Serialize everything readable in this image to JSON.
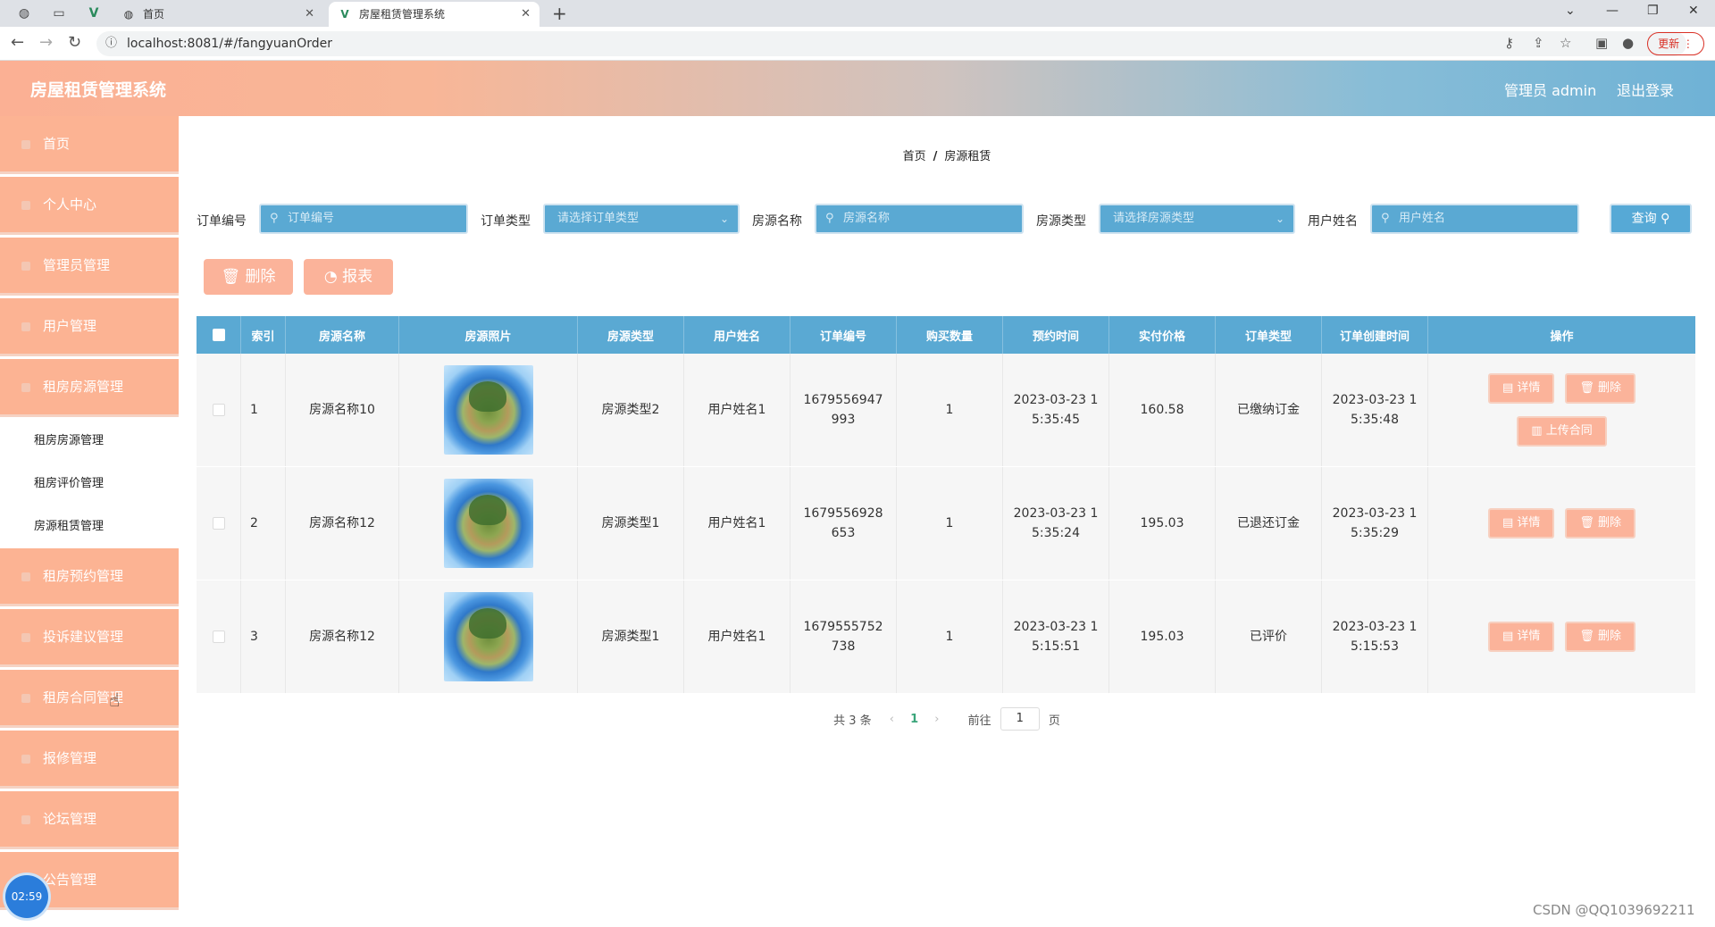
{
  "browser": {
    "tabs": [
      {
        "title": "首页"
      },
      {
        "title": "房屋租赁管理系统"
      }
    ],
    "url": "localhost:8081/#/fangyuanOrder",
    "update_label": "更新"
  },
  "header": {
    "title": "房屋租赁管理系统",
    "user_label": "管理员 admin",
    "logout_label": "退出登录"
  },
  "sidebar": {
    "items_top": [
      {
        "label": "首页"
      },
      {
        "label": "个人中心"
      },
      {
        "label": "管理员管理"
      },
      {
        "label": "用户管理"
      },
      {
        "label": "租房房源管理"
      }
    ],
    "sub_items": [
      {
        "label": "租房房源管理"
      },
      {
        "label": "租房评价管理"
      },
      {
        "label": "房源租赁管理"
      }
    ],
    "items_bottom": [
      {
        "label": "租房预约管理"
      },
      {
        "label": "投诉建议管理"
      },
      {
        "label": "租房合同管理"
      },
      {
        "label": "报修管理"
      },
      {
        "label": "论坛管理"
      },
      {
        "label": "公告管理"
      }
    ]
  },
  "timer": "02:59",
  "breadcrumb": {
    "home": "首页",
    "sep": "/",
    "current": "房源租赁"
  },
  "filters": {
    "order_no": {
      "label": "订单编号",
      "placeholder": "订单编号"
    },
    "order_type": {
      "label": "订单类型",
      "placeholder": "请选择订单类型"
    },
    "house_name": {
      "label": "房源名称",
      "placeholder": "房源名称"
    },
    "house_type": {
      "label": "房源类型",
      "placeholder": "请选择房源类型"
    },
    "user_name": {
      "label": "用户姓名",
      "placeholder": "用户姓名"
    },
    "query_label": "查询"
  },
  "actions": {
    "delete_label": "删除",
    "report_label": "报表"
  },
  "table": {
    "headers": [
      "索引",
      "房源名称",
      "房源照片",
      "房源类型",
      "用户姓名",
      "订单编号",
      "购买数量",
      "预约时间",
      "实付价格",
      "订单类型",
      "订单创建时间",
      "操作"
    ],
    "rows": [
      {
        "index": "1",
        "name": "房源名称10",
        "type": "房源类型2",
        "user": "用户姓名1",
        "order_no": "1679556947993",
        "qty": "1",
        "book_time": "2023-03-23 15:35:45",
        "price": "160.58",
        "order_type": "已缴纳订金",
        "created": "2023-03-23 15:35:48"
      },
      {
        "index": "2",
        "name": "房源名称12",
        "type": "房源类型1",
        "user": "用户姓名1",
        "order_no": "1679556928653",
        "qty": "1",
        "book_time": "2023-03-23 15:35:24",
        "price": "195.03",
        "order_type": "已退还订金",
        "created": "2023-03-23 15:35:29"
      },
      {
        "index": "3",
        "name": "房源名称12",
        "type": "房源类型1",
        "user": "用户姓名1",
        "order_no": "1679555752738",
        "qty": "1",
        "book_time": "2023-03-23 15:15:51",
        "price": "195.03",
        "order_type": "已评价",
        "created": "2023-03-23 15:15:53"
      }
    ],
    "op_detail": "详情",
    "op_delete": "删除",
    "op_upload": "上传合同"
  },
  "pagination": {
    "total_text": "共 3 条",
    "current_page": "1",
    "goto_label": "前往",
    "goto_value": "1",
    "page_suffix": "页"
  },
  "watermark": "CSDN @QQ1039692211"
}
